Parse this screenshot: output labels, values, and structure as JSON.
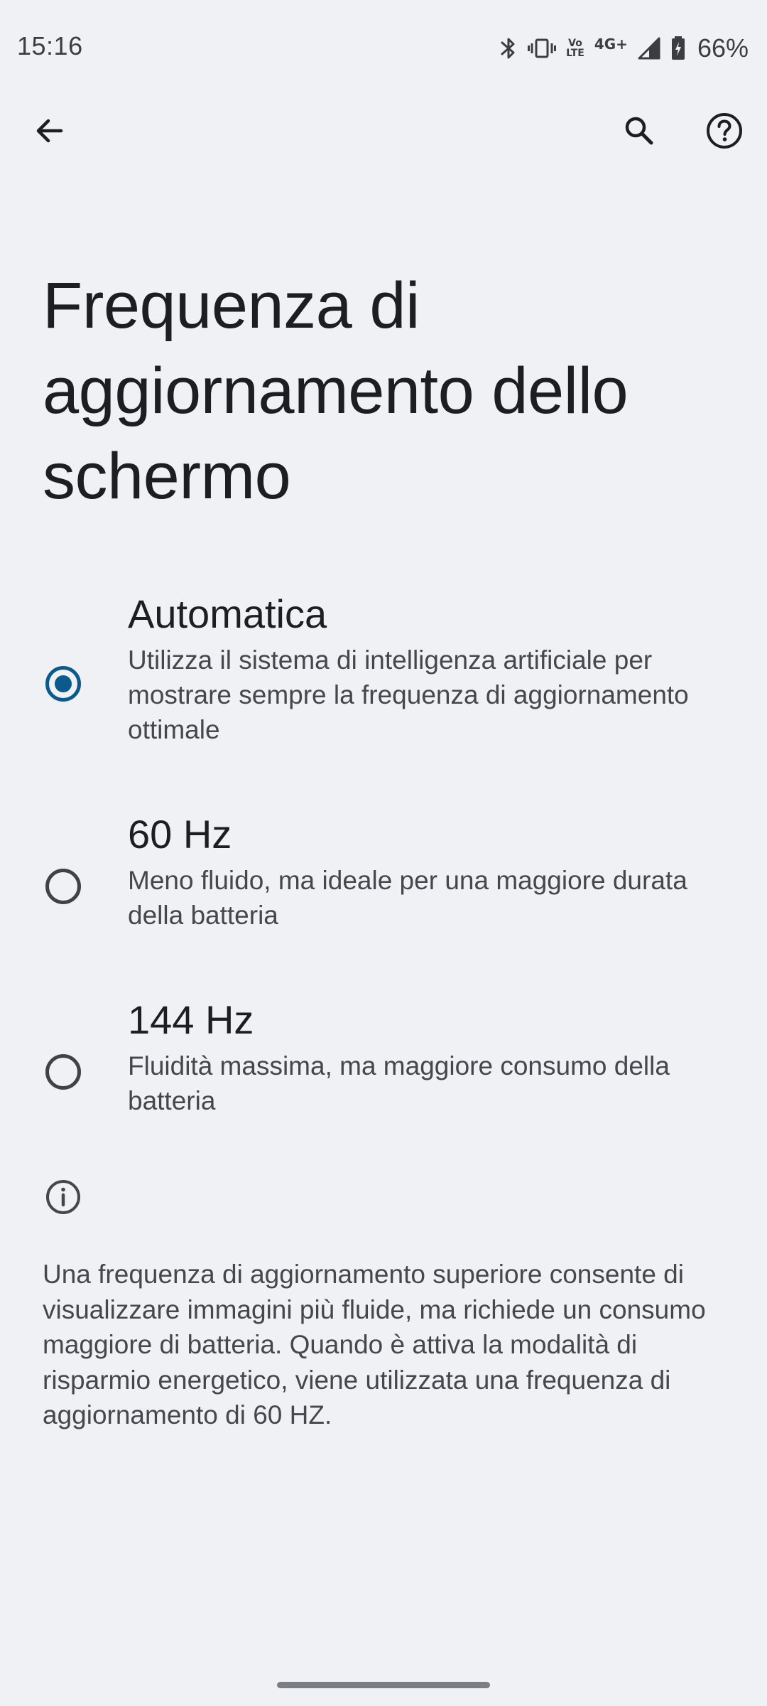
{
  "status_bar": {
    "time": "15:16",
    "lte_top": "Vo",
    "lte_bottom": "LTE",
    "network": "4G+",
    "battery": "66%",
    "icons": [
      "bluetooth-icon",
      "vibrate-icon",
      "volte-icon",
      "network-4g-icon",
      "signal-icon",
      "battery-charging-icon"
    ]
  },
  "app_bar": {
    "icons": [
      "back-arrow-icon",
      "search-icon",
      "help-icon"
    ]
  },
  "page": {
    "title": "Frequenza di aggiornamento dello schermo"
  },
  "options": [
    {
      "title": "Automatica",
      "description": "Utilizza il sistema di intelligenza artificiale per mostrare sempre la frequenza di aggiornamento ottimale",
      "selected": true
    },
    {
      "title": "60 Hz",
      "description": "Meno fluido, ma ideale per una maggiore durata della batteria",
      "selected": false
    },
    {
      "title": "144 Hz",
      "description": "Fluidità massima, ma maggiore consumo della batteria",
      "selected": false
    }
  ],
  "footer": {
    "icon": "info-icon",
    "text": "Una frequenza di aggiornamento superiore consente di visualizzare immagini più fluide, ma richiede un consumo maggiore di batteria. Quando è attiva la modalità di risparmio energetico, viene utilizzata una frequenza di aggiornamento di 60 HZ."
  },
  "colors": {
    "background": "#eff1f4",
    "accent": "#0a5b8c",
    "text_primary": "#1c1e22",
    "text_secondary": "#44474c"
  }
}
